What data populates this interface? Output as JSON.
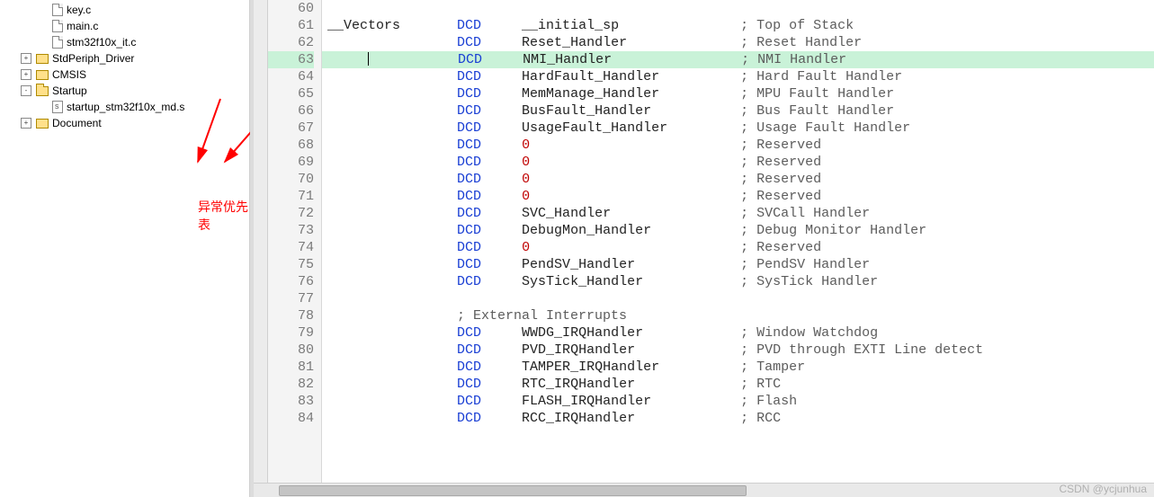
{
  "tree": {
    "items": [
      {
        "indent": 2,
        "exp": "",
        "icon": "file-c",
        "label": "key.c"
      },
      {
        "indent": 2,
        "exp": "",
        "icon": "file-c",
        "label": "main.c"
      },
      {
        "indent": 2,
        "exp": "",
        "icon": "file-c",
        "label": "stm32f10x_it.c"
      },
      {
        "indent": 1,
        "exp": "+",
        "icon": "folder",
        "label": "StdPeriph_Driver"
      },
      {
        "indent": 1,
        "exp": "+",
        "icon": "folder",
        "label": "CMSIS"
      },
      {
        "indent": 1,
        "exp": "-",
        "icon": "folder-open",
        "label": "Startup"
      },
      {
        "indent": 2,
        "exp": "",
        "icon": "file-s",
        "label": "startup_stm32f10x_md.s"
      },
      {
        "indent": 1,
        "exp": "+",
        "icon": "folder",
        "label": "Document"
      }
    ]
  },
  "annotation": "异常优先表",
  "watermark": "CSDN @ycjunhua",
  "code": {
    "lines": [
      {
        "n": 60,
        "pre": "",
        "dcd": "",
        "arg": "",
        "cm": "",
        "raw": true,
        "text": ""
      },
      {
        "n": 61,
        "pre": "__Vectors       ",
        "dcd": "DCD",
        "arg": "     __initial_sp",
        "cm": "               ; Top of Stack"
      },
      {
        "n": 62,
        "pre": "                ",
        "dcd": "DCD",
        "arg": "     Reset_Handler",
        "cm": "              ; Reset Handler"
      },
      {
        "n": 63,
        "hl": true,
        "pre": "                ",
        "dcd": "DCD",
        "arg": "     NMI_Handler",
        "cm": "                ; NMI Handler",
        "caret": true
      },
      {
        "n": 64,
        "pre": "                ",
        "dcd": "DCD",
        "arg": "     HardFault_Handler",
        "cm": "          ; Hard Fault Handler"
      },
      {
        "n": 65,
        "pre": "                ",
        "dcd": "DCD",
        "arg": "     MemManage_Handler",
        "cm": "          ; MPU Fault Handler"
      },
      {
        "n": 66,
        "pre": "                ",
        "dcd": "DCD",
        "arg": "     BusFault_Handler",
        "cm": "           ; Bus Fault Handler"
      },
      {
        "n": 67,
        "pre": "                ",
        "dcd": "DCD",
        "arg": "     UsageFault_Handler",
        "cm": "         ; Usage Fault Handler"
      },
      {
        "n": 68,
        "pre": "                ",
        "dcd": "DCD",
        "arg": "     ",
        "num": "0",
        "cm": "                          ; Reserved"
      },
      {
        "n": 69,
        "pre": "                ",
        "dcd": "DCD",
        "arg": "     ",
        "num": "0",
        "cm": "                          ; Reserved"
      },
      {
        "n": 70,
        "pre": "                ",
        "dcd": "DCD",
        "arg": "     ",
        "num": "0",
        "cm": "                          ; Reserved"
      },
      {
        "n": 71,
        "pre": "                ",
        "dcd": "DCD",
        "arg": "     ",
        "num": "0",
        "cm": "                          ; Reserved"
      },
      {
        "n": 72,
        "pre": "                ",
        "dcd": "DCD",
        "arg": "     SVC_Handler",
        "cm": "                ; SVCall Handler"
      },
      {
        "n": 73,
        "pre": "                ",
        "dcd": "DCD",
        "arg": "     DebugMon_Handler",
        "cm": "           ; Debug Monitor Handler"
      },
      {
        "n": 74,
        "pre": "                ",
        "dcd": "DCD",
        "arg": "     ",
        "num": "0",
        "cm": "                          ; Reserved"
      },
      {
        "n": 75,
        "pre": "                ",
        "dcd": "DCD",
        "arg": "     PendSV_Handler",
        "cm": "             ; PendSV Handler"
      },
      {
        "n": 76,
        "pre": "                ",
        "dcd": "DCD",
        "arg": "     SysTick_Handler",
        "cm": "            ; SysTick Handler"
      },
      {
        "n": 77,
        "pre": "",
        "dcd": "",
        "arg": "",
        "cm": "",
        "raw": true,
        "text": ""
      },
      {
        "n": 78,
        "pre": "",
        "dcd": "",
        "arg": "",
        "cm": "",
        "raw": true,
        "text": "                ; External Interrupts",
        "cmOnly": true
      },
      {
        "n": 79,
        "pre": "                ",
        "dcd": "DCD",
        "arg": "     WWDG_IRQHandler",
        "cm": "            ; Window Watchdog"
      },
      {
        "n": 80,
        "pre": "                ",
        "dcd": "DCD",
        "arg": "     PVD_IRQHandler",
        "cm": "             ; PVD through EXTI Line detect"
      },
      {
        "n": 81,
        "pre": "                ",
        "dcd": "DCD",
        "arg": "     TAMPER_IRQHandler",
        "cm": "          ; Tamper"
      },
      {
        "n": 82,
        "pre": "                ",
        "dcd": "DCD",
        "arg": "     RTC_IRQHandler",
        "cm": "             ; RTC"
      },
      {
        "n": 83,
        "pre": "                ",
        "dcd": "DCD",
        "arg": "     FLASH_IRQHandler",
        "cm": "           ; Flash"
      },
      {
        "n": 84,
        "pre": "                ",
        "dcd": "DCD",
        "arg": "     RCC_IRQHandler",
        "cm": "             ; RCC"
      }
    ]
  }
}
